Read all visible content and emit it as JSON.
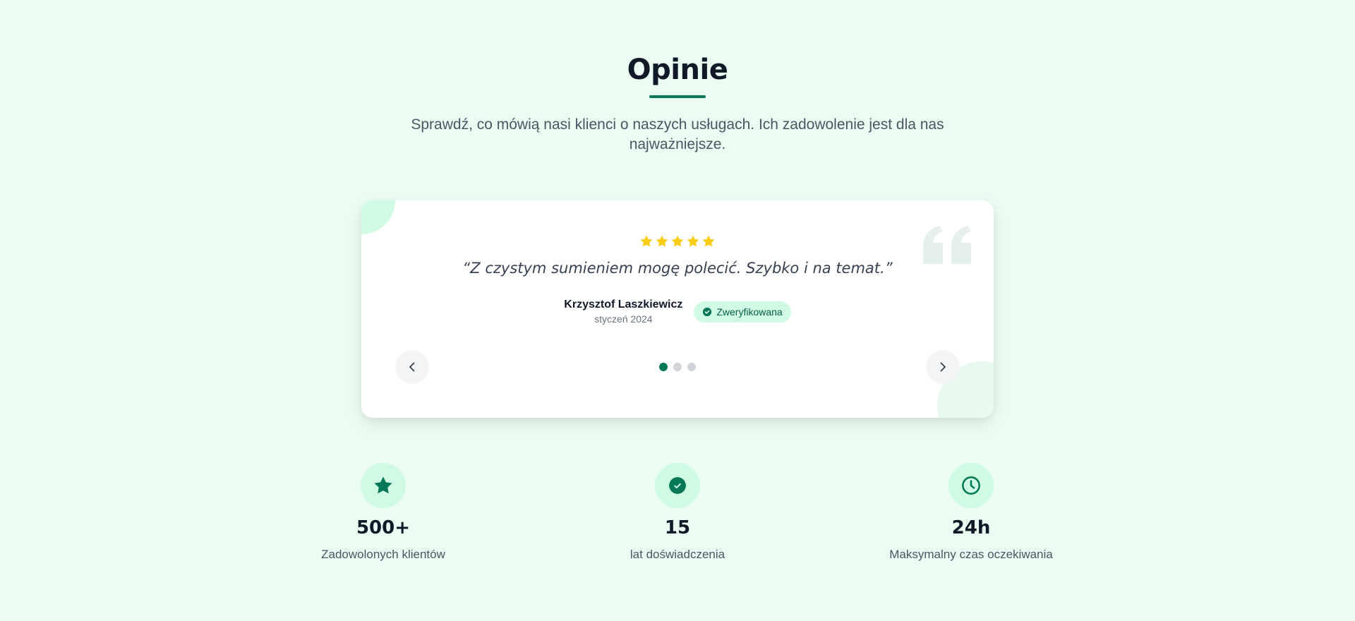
{
  "section": {
    "title": "Opinie",
    "subtitle": "Sprawdź, co mówią nasi klienci o naszych usługach. Ich zadowolenie jest dla nas najważniejsze."
  },
  "testimonial": {
    "rating": 5,
    "rating_max": 5,
    "quote": "“Z czystym sumieniem mogę polecić. Szybko i na temat.”",
    "author_name": "Krzysztof Laszkiewicz",
    "date": "styczeń 2024",
    "verified_label": "Zweryfikowana",
    "active_slide": 1,
    "slide_count": 3
  },
  "stats": [
    {
      "icon": "star-icon",
      "value": "500+",
      "label": "Zadowolonych klientów"
    },
    {
      "icon": "check-circle-icon",
      "value": "15",
      "label": "lat doświadczenia"
    },
    {
      "icon": "clock-icon",
      "value": "24h",
      "label": "Maksymalny czas oczekiwania"
    }
  ],
  "colors": {
    "background": "#ebfcf3",
    "accent": "#047857",
    "star": "#facc15",
    "badge_bg": "#d1fae5"
  }
}
